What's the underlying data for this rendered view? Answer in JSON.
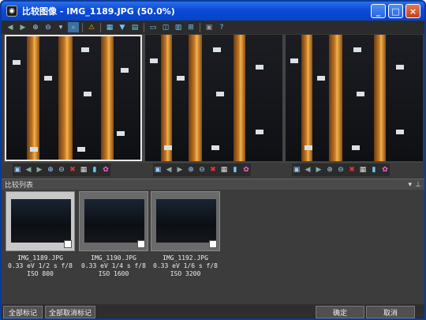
{
  "window": {
    "title": "比较图像 - IMG_1189.JPG (50.0%)",
    "app_icon": "compare-app-icon"
  },
  "window_controls": {
    "minimize": "_",
    "maximize": "□",
    "close": "×"
  },
  "toolbar": [
    "back-icon",
    "forward-icon",
    "zoom-in-icon",
    "zoom-out-icon",
    "zoom-dropdown-icon",
    "zoom-fit-icon",
    "warning-icon",
    "grid-icon",
    "filter-icon",
    "layout-icon",
    "single-view-icon",
    "dual-view-icon",
    "triple-view-icon",
    "quad-view-icon",
    "window-icon",
    "help-icon"
  ],
  "pane_tools": [
    "save-icon",
    "prev-icon",
    "next-icon",
    "zoom-in-icon",
    "zoom-out-icon",
    "delete-icon",
    "grid-icon",
    "rating-icon",
    "color-icon"
  ],
  "list": {
    "title": "比较列表",
    "items": [
      {
        "name": "IMG_1189.JPG",
        "exposure": "0.33 eV 1/2 s f/8",
        "iso": "ISO 800"
      },
      {
        "name": "IMG_1190.JPG",
        "exposure": "0.33 eV 1/4 s f/8",
        "iso": "ISO 1600"
      },
      {
        "name": "IMG_1192.JPG",
        "exposure": "0.33 eV 1/6 s f/8",
        "iso": "ISO 3200"
      }
    ]
  },
  "bottom": {
    "mark_all": "全部标记",
    "unmark_all": "全部取消标记",
    "ok": "确定",
    "cancel": "取消"
  },
  "colors": {
    "titlebar": "#0a4ad6",
    "background": "#3a3a3a",
    "accent_light": "#f3b24a"
  }
}
